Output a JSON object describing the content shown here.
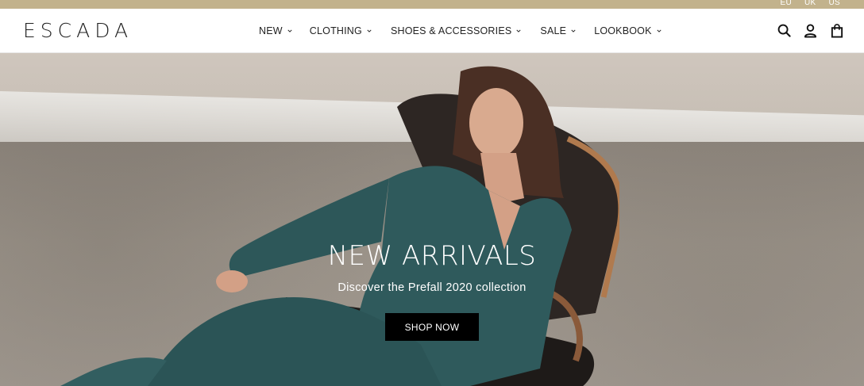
{
  "colors": {
    "topbar": "#c2b28c",
    "text": "#222222",
    "button_bg": "#000000",
    "button_text": "#ffffff"
  },
  "regions": [
    "EU",
    "UK",
    "US"
  ],
  "header": {
    "logo": "ESCADA",
    "nav": [
      {
        "label": "NEW",
        "icon": "chevron-down-icon"
      },
      {
        "label": "CLOTHING",
        "icon": "chevron-down-icon"
      },
      {
        "label": "SHOES & ACCESSORIES",
        "icon": "chevron-down-icon"
      },
      {
        "label": "SALE",
        "icon": "chevron-down-icon"
      },
      {
        "label": "LOOKBOOK",
        "icon": "chevron-down-icon"
      }
    ],
    "icons": [
      "search-icon",
      "account-icon",
      "shopping-bag-icon"
    ]
  },
  "hero": {
    "title": "NEW ARRIVALS",
    "subtitle": "Discover the Prefall 2020 collection",
    "button_label": "SHOP NOW"
  }
}
